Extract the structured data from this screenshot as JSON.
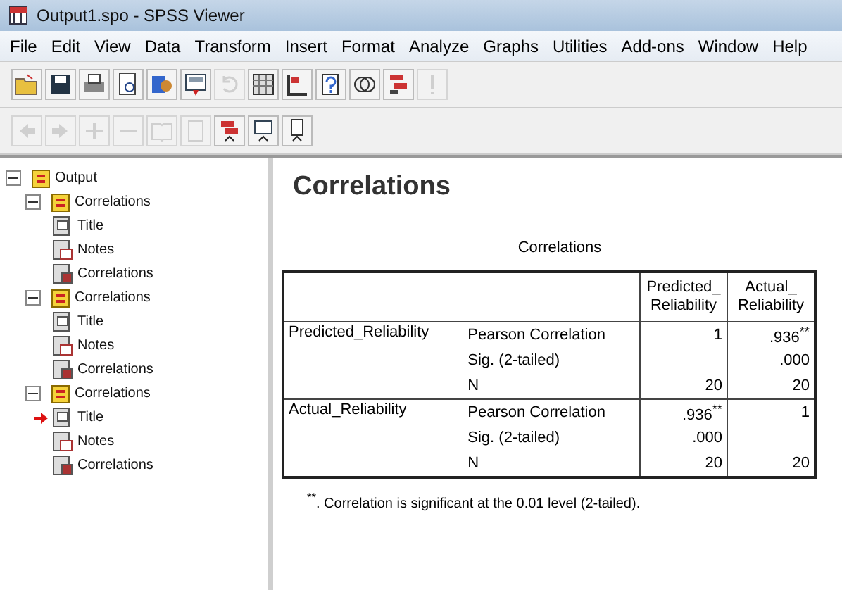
{
  "window": {
    "title": "Output1.spo - SPSS Viewer"
  },
  "menu": [
    "File",
    "Edit",
    "View",
    "Data",
    "Transform",
    "Insert",
    "Format",
    "Analyze",
    "Graphs",
    "Utilities",
    "Add-ons",
    "Window",
    "Help"
  ],
  "toolbar": [
    {
      "kind": "folder",
      "disabled": false
    },
    {
      "kind": "save",
      "disabled": false
    },
    {
      "kind": "print",
      "disabled": false
    },
    {
      "kind": "preview",
      "disabled": false
    },
    {
      "kind": "export",
      "disabled": false
    },
    {
      "kind": "dialog",
      "disabled": false
    },
    {
      "kind": "undo",
      "disabled": true
    },
    {
      "kind": "grid",
      "disabled": false
    },
    {
      "kind": "chart",
      "disabled": false
    },
    {
      "kind": "help",
      "disabled": false
    },
    {
      "kind": "circles",
      "disabled": false
    },
    {
      "kind": "flow",
      "disabled": false
    },
    {
      "kind": "run",
      "disabled": true
    }
  ],
  "toolbar2": [
    {
      "kind": "back",
      "disabled": true
    },
    {
      "kind": "forward",
      "disabled": true
    },
    {
      "kind": "plus",
      "disabled": true
    },
    {
      "kind": "minus",
      "disabled": true
    },
    {
      "kind": "book",
      "disabled": true
    },
    {
      "kind": "page",
      "disabled": true
    },
    {
      "kind": "flow",
      "disabled": false
    },
    {
      "kind": "dialog",
      "disabled": false
    },
    {
      "kind": "doc",
      "disabled": false
    }
  ],
  "outline": {
    "label": "Output",
    "expanded": true,
    "children": [
      {
        "label": "Correlations",
        "expanded": true,
        "children": [
          {
            "label": "Title",
            "kind": "title",
            "selected": false
          },
          {
            "label": "Notes",
            "kind": "notes",
            "selected": false
          },
          {
            "label": "Correlations",
            "kind": "table",
            "selected": false
          }
        ]
      },
      {
        "label": "Correlations",
        "expanded": true,
        "children": [
          {
            "label": "Title",
            "kind": "title",
            "selected": false
          },
          {
            "label": "Notes",
            "kind": "notes",
            "selected": false
          },
          {
            "label": "Correlations",
            "kind": "table",
            "selected": false
          }
        ]
      },
      {
        "label": "Correlations",
        "expanded": true,
        "children": [
          {
            "label": "Title",
            "kind": "title",
            "selected": true
          },
          {
            "label": "Notes",
            "kind": "notes",
            "selected": false
          },
          {
            "label": "Correlations",
            "kind": "table",
            "selected": false
          }
        ]
      }
    ]
  },
  "heading": "Correlations",
  "table": {
    "caption": "Correlations",
    "columns": [
      "Predicted_ Reliability",
      "Actual_ Reliability"
    ],
    "groups": [
      {
        "label": "Predicted_Reliability",
        "rows": [
          [
            "Pearson Correlation",
            "1",
            ".936$^{**}$"
          ],
          [
            "Sig. (2-tailed)",
            "",
            ".000"
          ],
          [
            "N",
            "20",
            "20"
          ]
        ]
      },
      {
        "label": "Actual_Reliability",
        "rows": [
          [
            "Pearson Correlation",
            ".936$^{**}$",
            "1"
          ],
          [
            "Sig. (2-tailed)",
            ".000",
            ""
          ],
          [
            "N",
            "20",
            "20"
          ]
        ]
      }
    ],
    "footnote": "$^{**}$. Correlation is significant at the 0.01 level (2-tailed)."
  }
}
